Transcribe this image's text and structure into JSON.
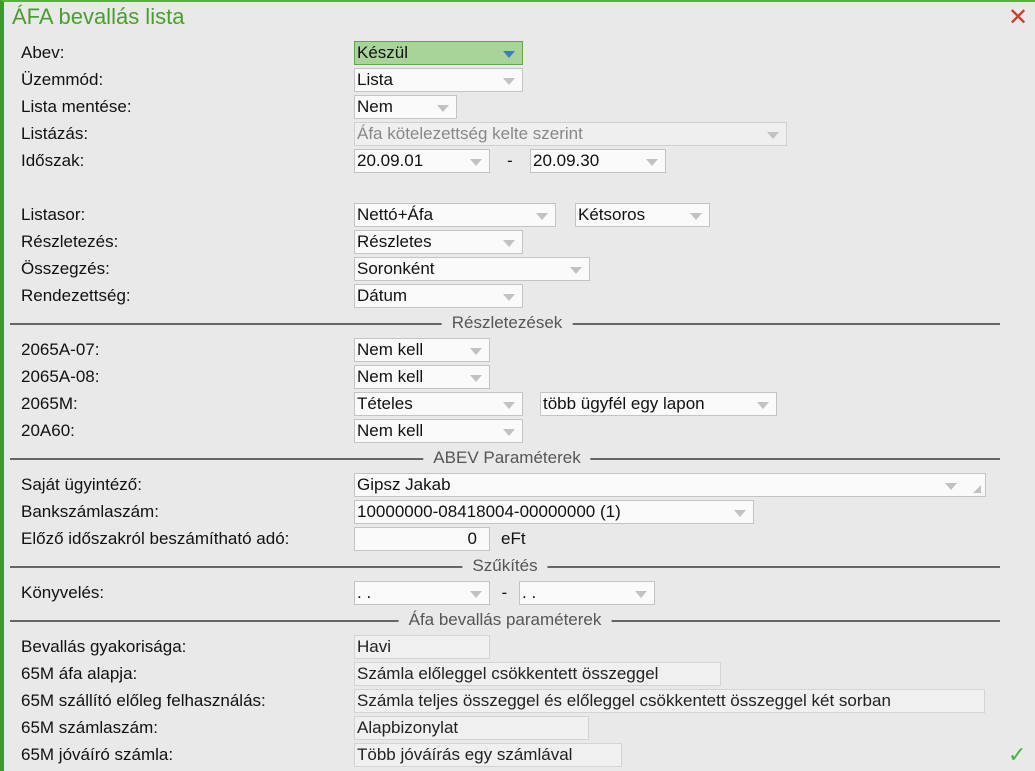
{
  "window": {
    "title": "ÁFA bevallás lista",
    "close_icon": "close-icon",
    "ok_icon": "check-icon"
  },
  "rows": [
    {
      "label": "Abev:",
      "fields": [
        "Készül"
      ]
    },
    {
      "label": "Üzemmód:",
      "fields": [
        "Lista"
      ]
    },
    {
      "label": "Lista mentése:",
      "fields": [
        "Nem"
      ]
    },
    {
      "label": "Listázás:",
      "fields": [
        "Áfa kötelezettség kelte szerint"
      ]
    },
    {
      "label": "Időszak:",
      "fields": [
        "20.09.01",
        "20.09.30"
      ],
      "dash": "-"
    },
    {
      "label": "Listasor:",
      "fields": [
        "Nettó+Áfa",
        "Kétsoros"
      ]
    },
    {
      "label": "Részletezés:",
      "fields": [
        "Részletes"
      ]
    },
    {
      "label": "Összegzés:",
      "fields": [
        "Soronként"
      ]
    },
    {
      "label": "Rendezettség:",
      "fields": [
        "Dátum"
      ]
    },
    {
      "label": "2065A-07:",
      "fields": [
        "Nem kell"
      ]
    },
    {
      "label": "2065A-08:",
      "fields": [
        "Nem kell"
      ]
    },
    {
      "label": "2065M:",
      "fields": [
        "Tételes",
        "több ügyfél egy lapon"
      ]
    },
    {
      "label": "20A60:",
      "fields": [
        "Nem kell"
      ]
    },
    {
      "label": "Saját ügyintéző:",
      "fields": [
        "Gipsz Jakab"
      ]
    },
    {
      "label": "Bankszámlaszám:",
      "fields": [
        "10000000-08418004-00000000 (1)"
      ]
    },
    {
      "label": "Előző időszakról beszámítható adó:",
      "fields": [
        "0"
      ],
      "unit": "eFt"
    },
    {
      "label": "Könyvelés:",
      "fields": [
        ". .",
        ". ."
      ],
      "dash": "-"
    },
    {
      "label": "Bevallás gyakorisága:",
      "fields": [
        "Havi"
      ]
    },
    {
      "label": "65M áfa alapja:",
      "fields": [
        "Számla előleggel csökkentett összeggel"
      ]
    },
    {
      "label": "65M szállító előleg  felhasználás:",
      "fields": [
        "Számla teljes összeggel és előleggel csökkentett összeggel két sorban"
      ]
    },
    {
      "label": "65M számlaszám:",
      "fields": [
        "Alapbizonylat"
      ]
    },
    {
      "label": "65M jóváíró számla:",
      "fields": [
        "Több jóváírás egy számlával"
      ]
    }
  ],
  "sections": [
    "Részletezések",
    "ABEV Paraméterek",
    "Szűkítés",
    "Áfa bevallás paraméterek"
  ],
  "colors": {
    "accent": "#4a9e2f",
    "highlight": "#a8d49a",
    "close": "#d23a2a"
  }
}
